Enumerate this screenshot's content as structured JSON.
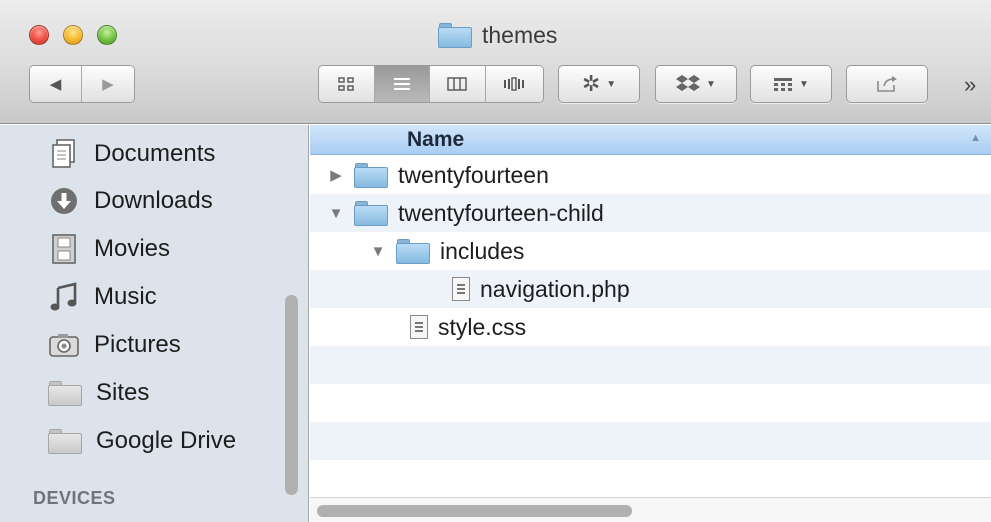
{
  "window": {
    "title": "themes"
  },
  "toolbar": {
    "back_label": "◀",
    "forward_label": "▶",
    "overflow_label": "»"
  },
  "sidebar": {
    "items": [
      {
        "label": "Documents",
        "icon": "documents-icon"
      },
      {
        "label": "Downloads",
        "icon": "downloads-icon"
      },
      {
        "label": "Movies",
        "icon": "movies-icon"
      },
      {
        "label": "Music",
        "icon": "music-icon"
      },
      {
        "label": "Pictures",
        "icon": "pictures-icon"
      },
      {
        "label": "Sites",
        "icon": "folder-icon"
      },
      {
        "label": "Google Drive",
        "icon": "folder-icon"
      }
    ],
    "devices_heading": "DEVICES"
  },
  "list": {
    "column_name": "Name",
    "rows": [
      {
        "name": "twentyfourteen",
        "kind": "folder",
        "expanded": false,
        "depth": 0
      },
      {
        "name": "twentyfourteen-child",
        "kind": "folder",
        "expanded": true,
        "depth": 0
      },
      {
        "name": "includes",
        "kind": "folder",
        "expanded": true,
        "depth": 1
      },
      {
        "name": "navigation.php",
        "kind": "file",
        "depth": 2
      },
      {
        "name": "style.css",
        "kind": "file",
        "depth": 1
      }
    ]
  },
  "colors": {
    "sidebar_bg": "#dde3ea",
    "header_blue": "#a9cdf2",
    "stripe": "#eef3fa"
  }
}
